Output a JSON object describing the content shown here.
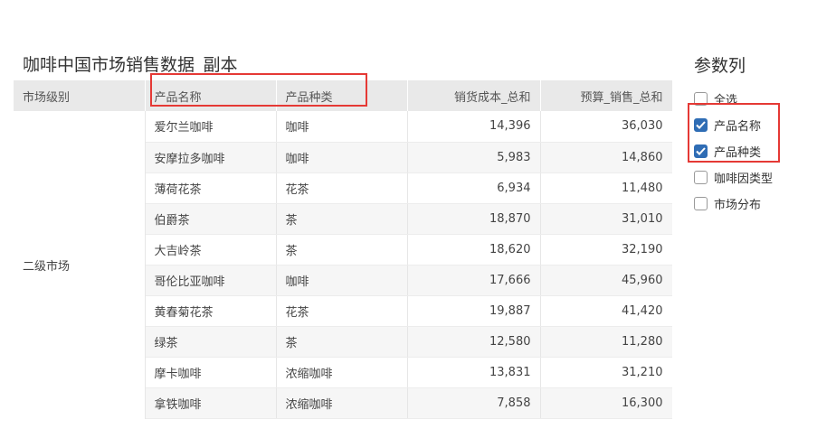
{
  "title": "咖啡中国市场销售数据_副本",
  "table": {
    "headers": [
      "市场级别",
      "产品名称",
      "产品种类",
      "销货成本_总和",
      "预算_销售_总和"
    ],
    "group_label": "二级市场",
    "rows": [
      {
        "name": "爱尔兰咖啡",
        "type": "咖啡",
        "cost": "14,396",
        "budget": "36,030"
      },
      {
        "name": "安摩拉多咖啡",
        "type": "咖啡",
        "cost": "5,983",
        "budget": "14,860"
      },
      {
        "name": "薄荷花茶",
        "type": "花茶",
        "cost": "6,934",
        "budget": "11,480"
      },
      {
        "name": "伯爵茶",
        "type": "茶",
        "cost": "18,870",
        "budget": "31,010"
      },
      {
        "name": "大吉岭茶",
        "type": "茶",
        "cost": "18,620",
        "budget": "32,190"
      },
      {
        "name": "哥伦比亚咖啡",
        "type": "咖啡",
        "cost": "17,666",
        "budget": "45,960"
      },
      {
        "name": "黄春菊花茶",
        "type": "花茶",
        "cost": "19,887",
        "budget": "41,420"
      },
      {
        "name": "绿茶",
        "type": "茶",
        "cost": "12,580",
        "budget": "11,280"
      },
      {
        "name": "摩卡咖啡",
        "type": "浓缩咖啡",
        "cost": "13,831",
        "budget": "31,210"
      },
      {
        "name": "拿铁咖啡",
        "type": "浓缩咖啡",
        "cost": "7,858",
        "budget": "16,300"
      }
    ]
  },
  "panel": {
    "title": "参数列",
    "options": [
      {
        "label": "全选",
        "checked": false
      },
      {
        "label": "产品名称",
        "checked": true
      },
      {
        "label": "产品种类",
        "checked": true
      },
      {
        "label": "咖啡因类型",
        "checked": false
      },
      {
        "label": "市场分布",
        "checked": false
      }
    ]
  },
  "colors": {
    "accent": "#2f6db5",
    "highlight": "#e53935",
    "header_bg": "#e9e9e9"
  }
}
